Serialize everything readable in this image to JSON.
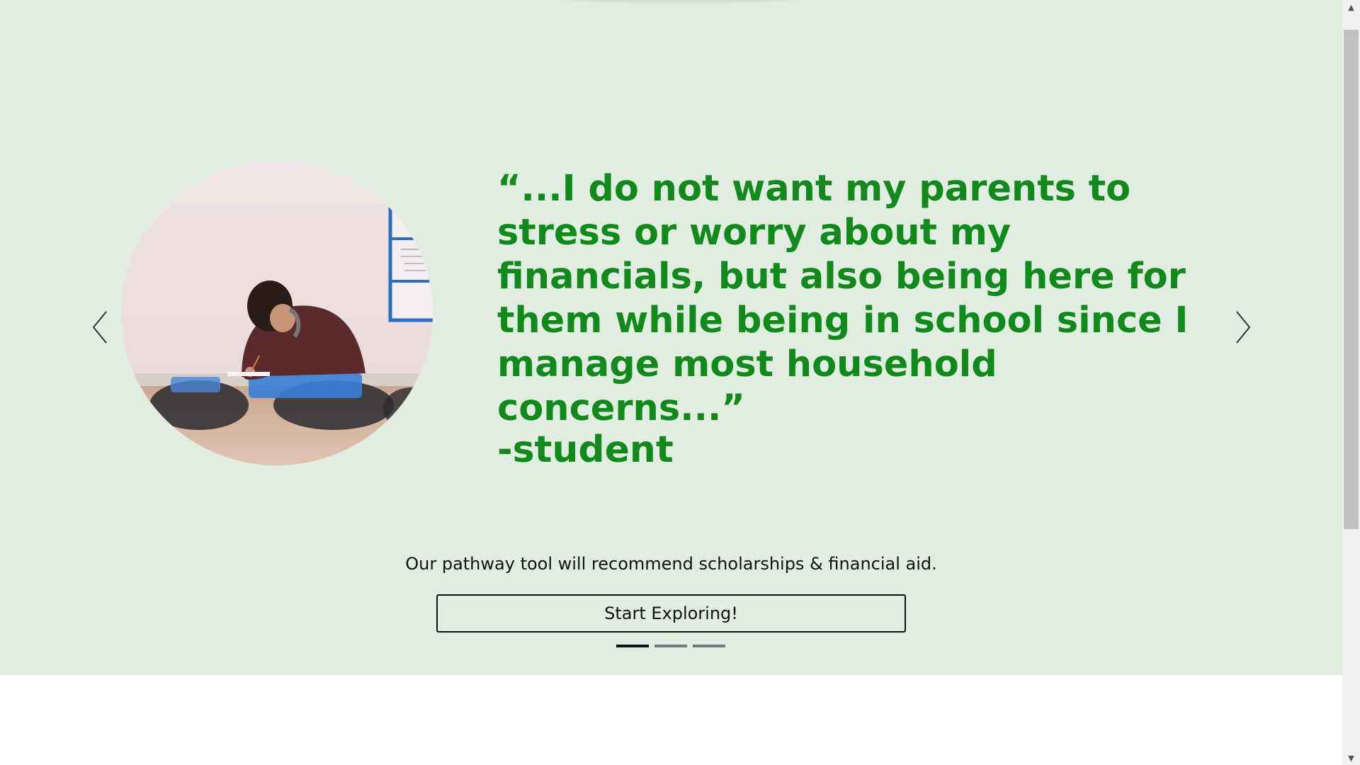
{
  "carousel": {
    "quote": "“...I do not want my parents to stress or worry about my financials, but also being here for them while being in school since I manage most household concerns...”",
    "attribution": "-student",
    "prev_icon": "chevron-left-icon",
    "next_icon": "chevron-right-icon",
    "slides_count": 3,
    "active_slide": 1
  },
  "cta": {
    "tagline": "Our pathway tool will recommend scholarships & financial aid.",
    "button_label": "Start Exploring!"
  },
  "colors": {
    "hero_background": "#e2ede1",
    "quote_text": "#128a1b",
    "page_background": "#ffffff"
  },
  "scrollbar": {
    "up_icon": "▲",
    "down_icon": "▼"
  }
}
